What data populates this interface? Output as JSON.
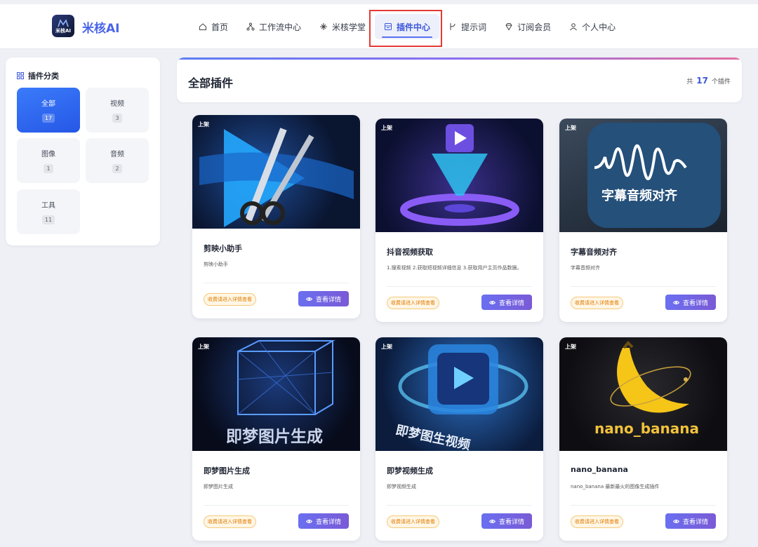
{
  "brand": {
    "logo_text": "米核AI",
    "logo_small": "米核AI"
  },
  "nav": {
    "items": [
      {
        "label": "首页",
        "icon": "home-icon"
      },
      {
        "label": "工作流中心",
        "icon": "workflow-icon"
      },
      {
        "label": "米核学堂",
        "icon": "academy-icon"
      },
      {
        "label": "插件中心",
        "icon": "plugin-icon",
        "active": true
      },
      {
        "label": "提示词",
        "icon": "prompt-icon"
      },
      {
        "label": "订阅会员",
        "icon": "diamond-icon"
      },
      {
        "label": "个人中心",
        "icon": "user-icon"
      }
    ]
  },
  "sidebar": {
    "title": "插件分类",
    "categories": [
      {
        "label": "全部",
        "count": "17",
        "active": true
      },
      {
        "label": "视频",
        "count": "3"
      },
      {
        "label": "图像",
        "count": "1"
      },
      {
        "label": "音频",
        "count": "2"
      },
      {
        "label": "工具",
        "count": "11"
      }
    ]
  },
  "main": {
    "title": "全部插件",
    "count_prefix": "共",
    "count": "17",
    "count_suffix": "个插件"
  },
  "cards": [
    {
      "tag": "上架",
      "name": "剪映小助手",
      "desc": "剪映小助手",
      "paid": "收费请进入详情查看",
      "button": "查看详情"
    },
    {
      "tag": "上架",
      "name": "抖音视频获取",
      "desc": "1.搜索视频 2.获取短视频详细信息 3.获取用户主页作品数据。",
      "paid": "收费请进入详情查看",
      "button": "查看详情"
    },
    {
      "tag": "上架",
      "name": "字幕音频对齐",
      "desc": "字幕音频对齐",
      "paid": "收费请进入详情查看",
      "button": "查看详情",
      "img_text": "字幕音频对齐"
    },
    {
      "tag": "上架",
      "name": "即梦图片生成",
      "desc": "即梦图片生成",
      "paid": "收费请进入详情查看",
      "button": "查看详情",
      "img_text": "即梦图片生成"
    },
    {
      "tag": "上架",
      "name": "即梦视频生成",
      "desc": "即梦视频生成",
      "paid": "收费请进入详情查看",
      "button": "查看详情",
      "img_text": "即梦图生视频"
    },
    {
      "tag": "上架",
      "name": "nano_banana",
      "desc": "nano_banana 最新最火的图像生成插件",
      "paid": "收费请进入详情查看",
      "button": "查看详情",
      "img_text": "nano_banana"
    }
  ]
}
